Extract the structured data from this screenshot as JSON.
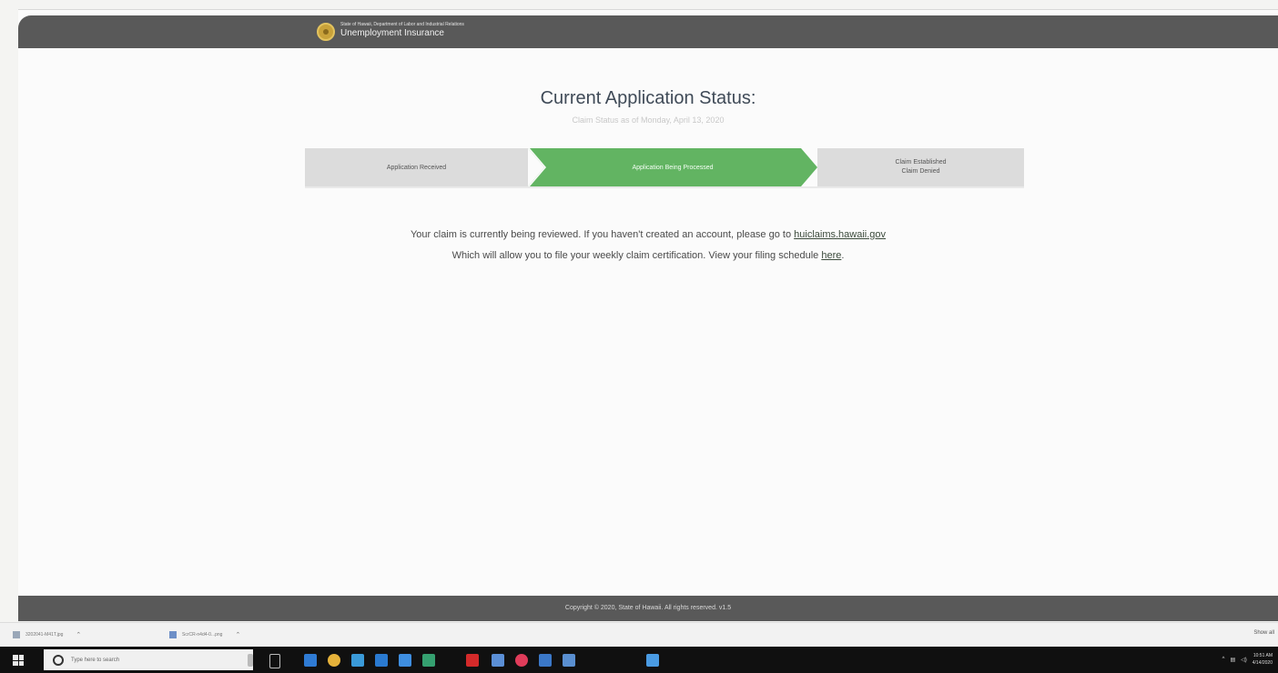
{
  "header": {
    "agency_line1": "State of Hawaii, Department of Labor and Industrial Relations",
    "agency_line2": "Unemployment Insurance"
  },
  "status": {
    "title": "Current Application Status:",
    "subtitle": "Claim Status as of Monday, April 13, 2020",
    "steps": [
      {
        "label": "Application Received",
        "state": "complete"
      },
      {
        "label": "Application Being Processed",
        "state": "current"
      },
      {
        "label_top": "Claim Established",
        "label_bottom": "Claim Denied",
        "state": "pending"
      }
    ]
  },
  "message": {
    "line1_prefix": "Your claim is currently being reviewed. If you haven't created an account, please go to ",
    "line1_link": "huiclaims.hawaii.gov",
    "line2_prefix": "Which will allow you to file your weekly claim certification. View your filing schedule ",
    "line2_link": "here",
    "line2_suffix": "."
  },
  "footer": {
    "text": "Copyright © 2020, State of Hawaii. All rights reserved.   v1.5"
  },
  "downloads": {
    "items": [
      "3202041-M41T.jpg",
      "ScrCR-n4d4-0...png"
    ],
    "show_all": "Show all"
  },
  "taskbar": {
    "search_placeholder": "Type here to search",
    "time": "10:51 AM",
    "date": "4/14/2020"
  },
  "colors": {
    "header_bg": "#595959",
    "active_step": "#62b462",
    "inactive_step": "#dcdcdc"
  }
}
